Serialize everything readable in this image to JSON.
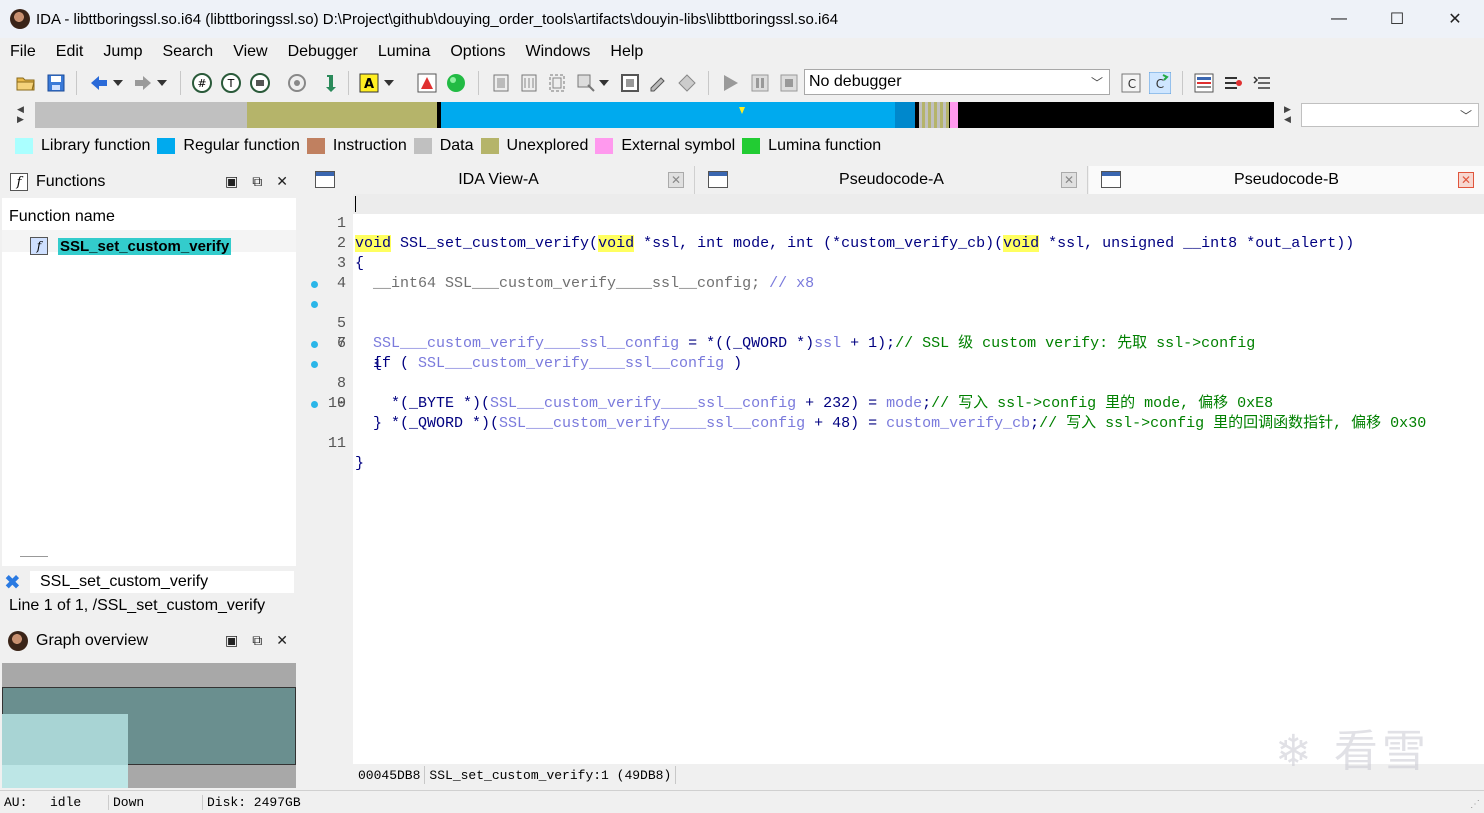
{
  "window": {
    "title": "IDA - libttboringssl.so.i64 (libttboringssl.so) D:\\Project\\github\\douying_order_tools\\artifacts\\douyin-libs\\libttboringssl.so.i64",
    "minimize": "—",
    "maximize": "☐",
    "close": "✕"
  },
  "menu": [
    "File",
    "Edit",
    "Jump",
    "Search",
    "View",
    "Debugger",
    "Lumina",
    "Options",
    "Windows",
    "Help"
  ],
  "toolbar": {
    "debugger_select": "No debugger"
  },
  "legend": [
    {
      "label": "Library function",
      "color": "#aaffff"
    },
    {
      "label": "Regular function",
      "color": "#00aaee"
    },
    {
      "label": "Instruction",
      "color": "#c08060"
    },
    {
      "label": "Data",
      "color": "#c0c0c0"
    },
    {
      "label": "Unexplored",
      "color": "#b5b46a"
    },
    {
      "label": "External symbol",
      "color": "#ff99ee"
    },
    {
      "label": "Lumina function",
      "color": "#22cc33"
    }
  ],
  "functions_panel": {
    "title": "Functions",
    "column_header": "Function name",
    "items": [
      "SSL_set_custom_verify"
    ],
    "search_value": "SSL_set_custom_verify",
    "line_info": "Line 1 of 1, /SSL_set_custom_verify"
  },
  "graph_panel": {
    "title": "Graph overview"
  },
  "tabs": [
    {
      "label": "IDA View-A"
    },
    {
      "label": "Pseudocode-A"
    },
    {
      "label": "Pseudocode-B"
    }
  ],
  "code": {
    "line_numbers": [
      "1",
      "2",
      "3",
      "4",
      "5",
      "6",
      "7",
      "8",
      "9",
      "10",
      "11"
    ],
    "l1": {
      "t1": "void",
      "t2": " SSL_set_custom_verify(",
      "t3": "void",
      "t4": " *ssl, int mode, int (*custom_verify_cb)(",
      "t5": "void",
      "t6": " *ssl, unsigned __int8 *out_alert))"
    },
    "l2": "{",
    "l3": {
      "decl": "  __int64 SSL___custom_verify____ssl__config; ",
      "cmt": "// x8"
    },
    "l5": {
      "a": "SSL___custom_verify____ssl__config",
      "b": " = *((_QWORD *)",
      "c": "ssl",
      "d": " + 1);",
      "cmt": "// SSL 级 custom verify: 先取 ssl->config"
    },
    "l6": {
      "a": "  if ( ",
      "b": "SSL___custom_verify____ssl__config",
      "c": " )"
    },
    "l7": "  {",
    "l8": {
      "a": "    *(_BYTE *)(",
      "b": "SSL___custom_verify____ssl__config",
      "c": " + 232) = ",
      "d": "mode",
      "e": ";",
      "cmt": "// 写入 ssl->config 里的 mode, 偏移 0xE8"
    },
    "l9": {
      "a": "    *(_QWORD *)(",
      "b": "SSL___custom_verify____ssl__config",
      "c": " + 48) = ",
      "d": "custom_verify_cb",
      "e": ";",
      "cmt": "// 写入 ssl->config 里的回调函数指针, 偏移 0x30"
    },
    "l10": "  }",
    "l11": "}"
  },
  "code_status": {
    "address": "00045DB8",
    "location": "SSL_set_custom_verify:1 (49DB8)"
  },
  "statusbar": {
    "au": "AU:",
    "state": "idle",
    "direction": "Down",
    "disk": "Disk: 2497GB"
  },
  "watermark": "❄ 看雪"
}
